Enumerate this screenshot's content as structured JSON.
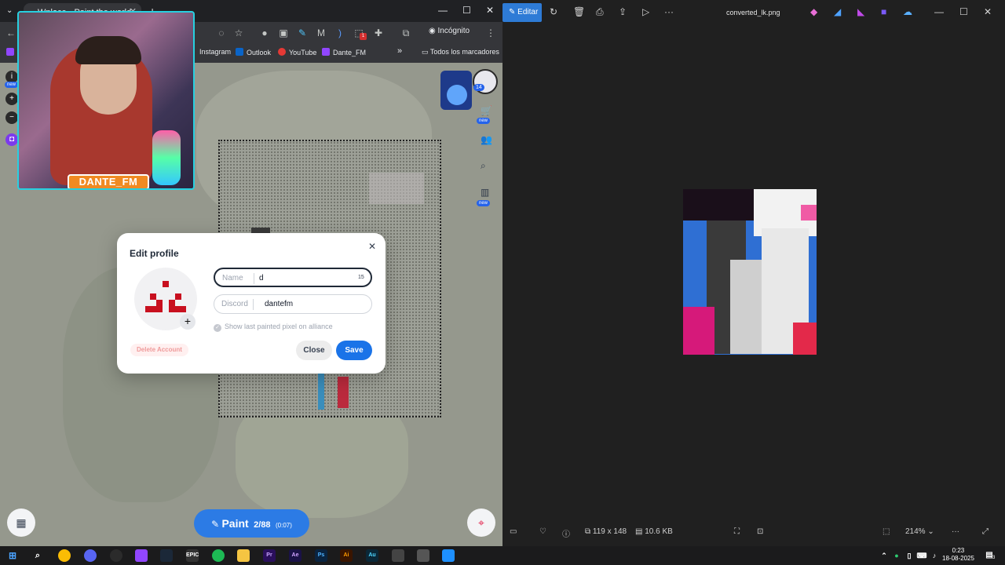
{
  "browser": {
    "tab_title": "Wplace - Paint the world",
    "incognito_label": "Incógnito",
    "bookmarks": [
      "Instagram",
      "Outlook",
      "YouTube",
      "Dante_FM"
    ],
    "bookmarks_more": "»",
    "bookmarks_folder": "Todos los marcadores",
    "extension_badge": "1"
  },
  "streamer": {
    "label": "DANTE_FM"
  },
  "map": {
    "side_new_badge": "new",
    "tools_new_badge": "new",
    "stats_new_badge": "new",
    "avatar_count": "14"
  },
  "dialog": {
    "title": "Edit profile",
    "name_label": "Name",
    "name_value": "d",
    "name_counter": "15",
    "discord_label": "Discord",
    "discord_value": "dantefm",
    "alliance_label": "Show last painted pixel on alliance",
    "delete_label": "Delete Account",
    "close_label": "Close",
    "save_label": "Save"
  },
  "paint": {
    "label": "Paint",
    "count": "2/88",
    "timer": "(0:07)"
  },
  "viewer": {
    "edit_label": "Editar",
    "filename": "converted_lk.png",
    "dimensions": "119 x 148",
    "filesize": "10.6 KB",
    "zoom": "214%"
  },
  "taskbar": {
    "time": "0:23",
    "date": "18-08-2025",
    "notifications": "3"
  },
  "colors": {
    "accent": "#1a73e8",
    "webcam_border": "#27d0e0",
    "label_orange": "#f08a22",
    "avatar_pixel": "#c8101f"
  }
}
